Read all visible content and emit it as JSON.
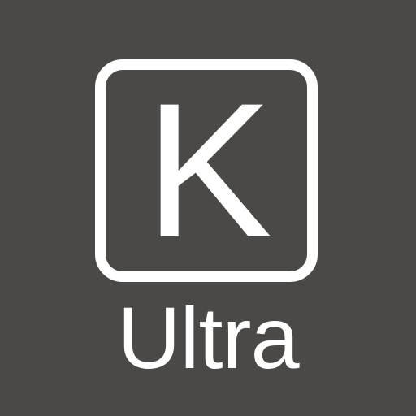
{
  "icon": {
    "key_letter": "K",
    "label": "Ultra",
    "icon_name": "keyboard-key-icon"
  },
  "colors": {
    "background": "#4a4948",
    "foreground": "#ffffff"
  }
}
